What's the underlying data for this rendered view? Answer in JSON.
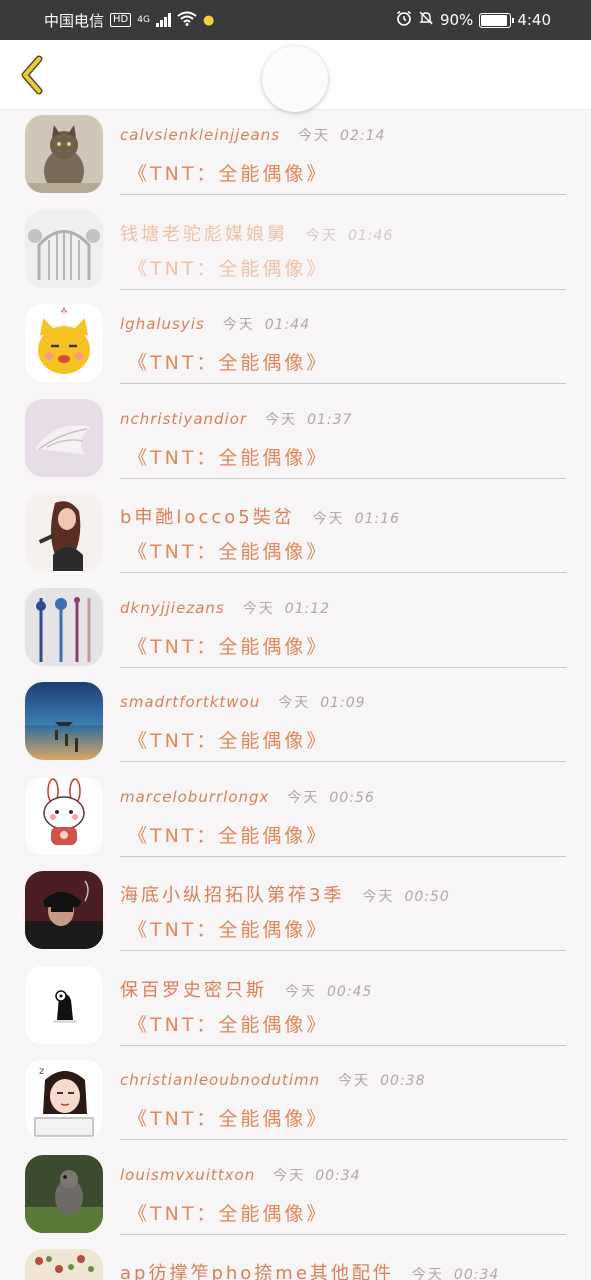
{
  "status_bar": {
    "carrier": "中国电信",
    "hd": "HD",
    "network": "4G",
    "battery_percent": "90%",
    "time": "4:40",
    "battery_level": 0.9
  },
  "header": {
    "back_icon": "chevron-left-icon",
    "accent_color": "#e9c94a"
  },
  "messages": [
    {
      "name": "calvsienkleinjjeans",
      "day": "今天",
      "time": "02:14",
      "text": "《TNT：全能偶像》"
    },
    {
      "name": "钱塘老驼彪媒娘舅",
      "day": "今天",
      "time": "01:46",
      "text": "《TNT：全能偶像》"
    },
    {
      "name": "lghalusyis",
      "day": "今天",
      "time": "01:44",
      "text": "《TNT：全能偶像》"
    },
    {
      "name": "nchristiyandior",
      "day": "今天",
      "time": "01:37",
      "text": "《TNT：全能偶像》"
    },
    {
      "name": "b申酏locco5奘岔",
      "day": "今天",
      "time": "01:16",
      "text": "《TNT：全能偶像》"
    },
    {
      "name": "dknyjjiezans",
      "day": "今天",
      "time": "01:12",
      "text": "《TNT：全能偶像》"
    },
    {
      "name": "smadrtfortktwou",
      "day": "今天",
      "time": "01:09",
      "text": "《TNT：全能偶像》"
    },
    {
      "name": "marceloburrlongx",
      "day": "今天",
      "time": "00:56",
      "text": "《TNT：全能偶像》"
    },
    {
      "name": "海底小纵招拓队第莋3季",
      "day": "今天",
      "time": "00:50",
      "text": "《TNT：全能偶像》"
    },
    {
      "name": "保百罗史密只斯",
      "day": "今天",
      "time": "00:45",
      "text": "《TNT：全能偶像》"
    },
    {
      "name": "christianleoubnodutimn",
      "day": "今天",
      "time": "00:38",
      "text": "《TNT：全能偶像》"
    },
    {
      "name": "louismvxuittxon",
      "day": "今天",
      "time": "00:34",
      "text": "《TNT：全能偶像》"
    },
    {
      "name": "ap彷撑笮pho捺me其他配件",
      "day": "今天",
      "time": "00:34",
      "text": ""
    }
  ],
  "colors": {
    "name": "#d9805a",
    "message": "#e0895e",
    "time": "#b0aaa8",
    "divider": "#c8c8c8",
    "background": "#f7f5f5"
  }
}
